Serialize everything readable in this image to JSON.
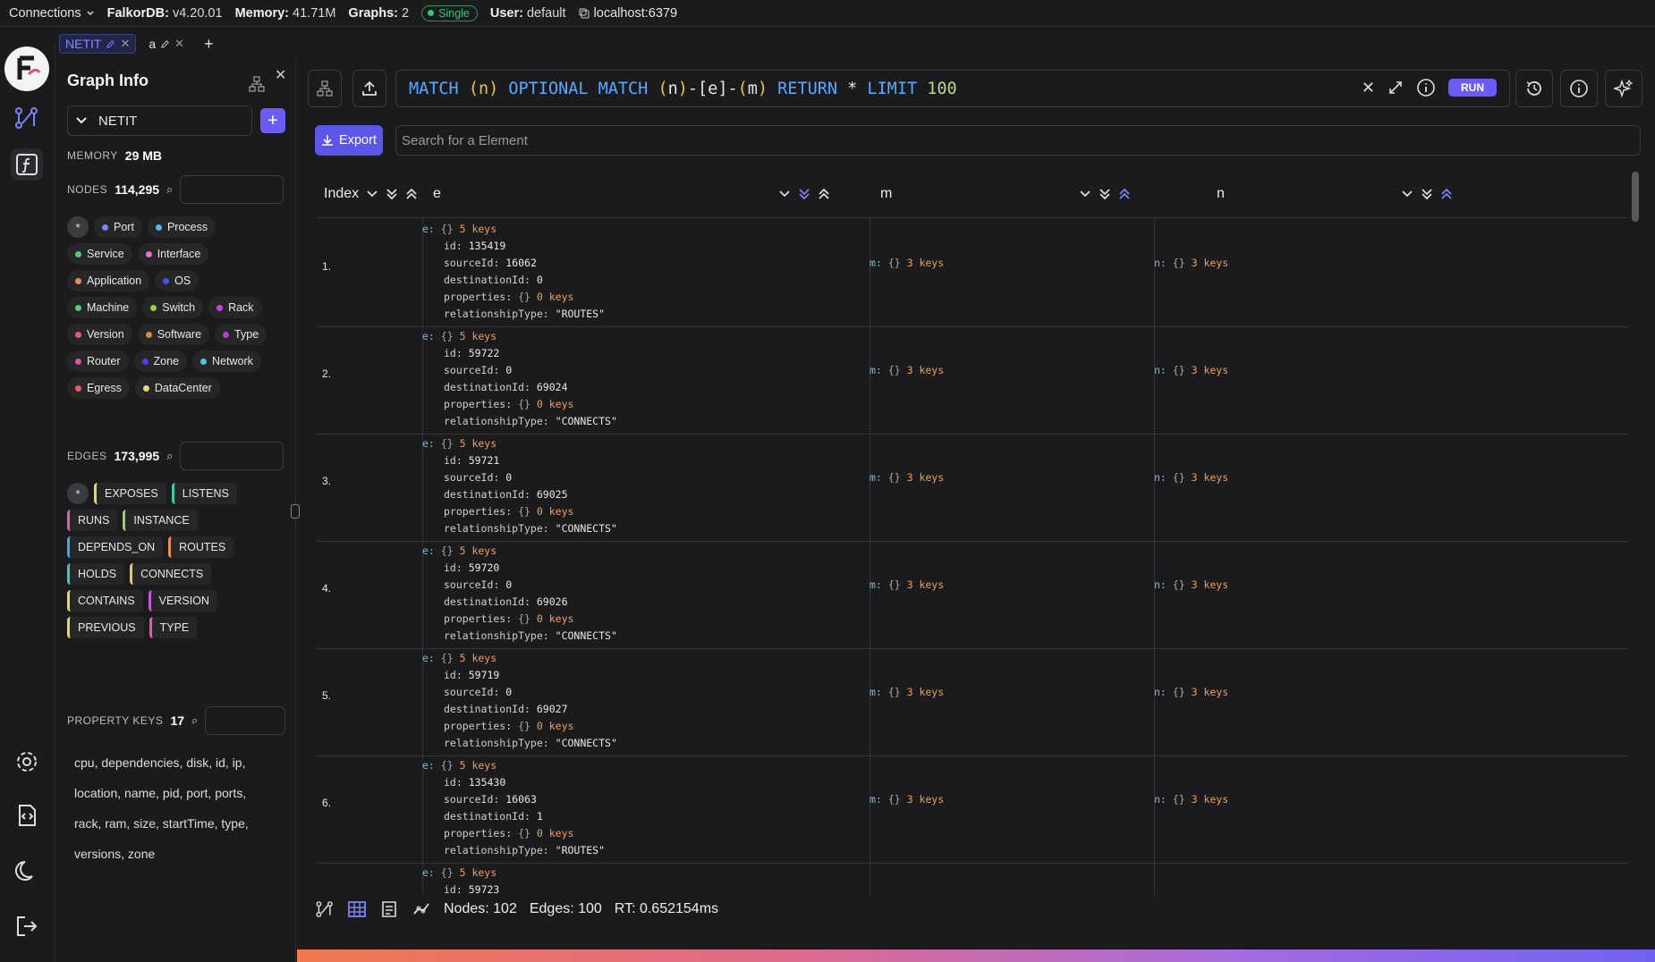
{
  "topbar": {
    "connections": "Connections",
    "db_label": "FalkorDB:",
    "db_version": "v4.20.01",
    "memory_label": "Memory:",
    "memory_value": "41.71M",
    "graphs_label": "Graphs:",
    "graphs_value": "2",
    "mode": "Single",
    "user_label": "User:",
    "user_value": "default",
    "host": "localhost:6379"
  },
  "tabs": [
    {
      "label": "NETIT"
    },
    {
      "label": "a"
    }
  ],
  "sidebar": {
    "title": "Graph Info",
    "graph_selected": "NETIT",
    "memory_label": "MEMORY",
    "memory_value": "29 MB",
    "nodes_label": "NODES",
    "nodes_count": "114,295",
    "edges_label": "EDGES",
    "edges_count": "173,995",
    "props_label": "PROPERTY KEYS",
    "props_count": "17",
    "labels": [
      {
        "name": "Port",
        "color": "#7b86f5"
      },
      {
        "name": "Process",
        "color": "#5bb5e0"
      },
      {
        "name": "Service",
        "color": "#5cc879"
      },
      {
        "name": "Interface",
        "color": "#e46fc6"
      },
      {
        "name": "Application",
        "color": "#e8885b"
      },
      {
        "name": "OS",
        "color": "#3a54e8"
      },
      {
        "name": "Machine",
        "color": "#5cc879"
      },
      {
        "name": "Switch",
        "color": "#9ad23b"
      },
      {
        "name": "Rack",
        "color": "#c43fe8"
      },
      {
        "name": "Version",
        "color": "#e85a6b"
      },
      {
        "name": "Software",
        "color": "#d88a3b"
      },
      {
        "name": "Type",
        "color": "#b43fd8"
      },
      {
        "name": "Router",
        "color": "#e04fa8"
      },
      {
        "name": "Zone",
        "color": "#5a3be8"
      },
      {
        "name": "Network",
        "color": "#4fc3e0"
      },
      {
        "name": "Egress",
        "color": "#e85a6b"
      },
      {
        "name": "DataCenter",
        "color": "#e8d87a"
      }
    ],
    "edges": [
      {
        "name": "EXPOSES",
        "color": "#e8d85a"
      },
      {
        "name": "LISTENS",
        "color": "#3fc8a8"
      },
      {
        "name": "RUNS",
        "color": "#e85ab0"
      },
      {
        "name": "INSTANCE",
        "color": "#8ad85a"
      },
      {
        "name": "DEPENDS_ON",
        "color": "#3fa8e8"
      },
      {
        "name": "ROUTES",
        "color": "#e8905a"
      },
      {
        "name": "HOLDS",
        "color": "#3fc8b8"
      },
      {
        "name": "CONNECTS",
        "color": "#e8c85a"
      },
      {
        "name": "CONTAINS",
        "color": "#e8d85a"
      },
      {
        "name": "VERSION",
        "color": "#c85ad8"
      },
      {
        "name": "PREVIOUS",
        "color": "#e8d85a"
      },
      {
        "name": "TYPE",
        "color": "#e85ab0"
      }
    ],
    "property_keys_lines": [
      "cpu, dependencies, disk, id, ip,",
      "location, name, pid, port, ports,",
      "rack, ram, size, startTime, type,",
      "versions, zone"
    ]
  },
  "query": {
    "tokens": [
      {
        "t": "MATCH ",
        "c": "kw"
      },
      {
        "t": "(",
        "c": "var"
      },
      {
        "t": "n",
        "c": "var"
      },
      {
        "t": ") ",
        "c": "var"
      },
      {
        "t": "OPTIONAL MATCH ",
        "c": "kw"
      },
      {
        "t": "(",
        "c": "var"
      },
      {
        "t": "n",
        "c": "op"
      },
      {
        "t": ")",
        "c": "var"
      },
      {
        "t": "-[",
        "c": "op"
      },
      {
        "t": "e",
        "c": "op"
      },
      {
        "t": "]-",
        "c": "op"
      },
      {
        "t": "(",
        "c": "var"
      },
      {
        "t": "m",
        "c": "op"
      },
      {
        "t": ") ",
        "c": "var"
      },
      {
        "t": "RETURN ",
        "c": "kw"
      },
      {
        "t": "* ",
        "c": "op"
      },
      {
        "t": "LIMIT ",
        "c": "kw"
      },
      {
        "t": "100",
        "c": "num"
      }
    ],
    "run_label": "RUN"
  },
  "toolbar": {
    "export_label": "Export",
    "search_placeholder": "Search for a Element"
  },
  "table": {
    "columns": [
      "Index",
      "e",
      "m",
      "n"
    ],
    "rows": [
      {
        "index": "1.",
        "id": "135419",
        "sourceId": "16062",
        "destinationId": "0",
        "relationshipType": "\"ROUTES\""
      },
      {
        "index": "2.",
        "id": "59722",
        "sourceId": "0",
        "destinationId": "69024",
        "relationshipType": "\"CONNECTS\""
      },
      {
        "index": "3.",
        "id": "59721",
        "sourceId": "0",
        "destinationId": "69025",
        "relationshipType": "\"CONNECTS\""
      },
      {
        "index": "4.",
        "id": "59720",
        "sourceId": "0",
        "destinationId": "69026",
        "relationshipType": "\"CONNECTS\""
      },
      {
        "index": "5.",
        "id": "59719",
        "sourceId": "0",
        "destinationId": "69027",
        "relationshipType": "\"CONNECTS\""
      },
      {
        "index": "6.",
        "id": "135430",
        "sourceId": "16063",
        "destinationId": "1",
        "relationshipType": "\"ROUTES\""
      },
      {
        "index": "",
        "id": "59723",
        "sourceId": "",
        "destinationId": "",
        "relationshipType": ""
      }
    ],
    "e_prefix": "e:",
    "m_prefix": "m:",
    "n_prefix": "n:",
    "braces": "{}",
    "e_keys": "5 keys",
    "mn_keys": "3 keys",
    "props_keys": "0 keys",
    "key_id": "id:",
    "key_source": "sourceId:",
    "key_dest": "destinationId:",
    "key_props": "properties:",
    "key_reltype": "relationshipType:"
  },
  "status": {
    "nodes": "Nodes: 102",
    "edges": "Edges: 100",
    "rt": "RT: 0.652154ms"
  }
}
